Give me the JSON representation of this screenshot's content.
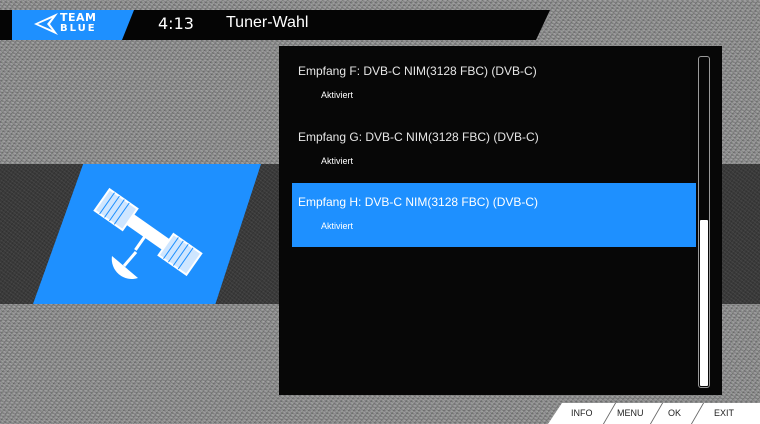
{
  "header": {
    "logo_line1": "TEAM",
    "logo_line2": "BLUE",
    "time": "4:13",
    "title": "Tuner-Wahl"
  },
  "tuner_list": {
    "items": [
      {
        "name": "Empfang F: DVB-C NIM(3128 FBC) (DVB-C)",
        "status": "Aktiviert",
        "selected": false
      },
      {
        "name": "Empfang G: DVB-C NIM(3128 FBC) (DVB-C)",
        "status": "Aktiviert",
        "selected": false
      },
      {
        "name": "Empfang H: DVB-C NIM(3128 FBC) (DVB-C)",
        "status": "Aktiviert",
        "selected": true
      }
    ],
    "scroll_position_fraction": 0.5
  },
  "footer": {
    "keys": [
      "INFO",
      "MENU",
      "OK",
      "EXIT"
    ]
  },
  "icons": {
    "logo": "team-blue-logo",
    "panel": "satellite-icon"
  },
  "colors": {
    "accent": "#1e90ff",
    "panel_bg": "#070707",
    "header_bg": "#050505"
  }
}
